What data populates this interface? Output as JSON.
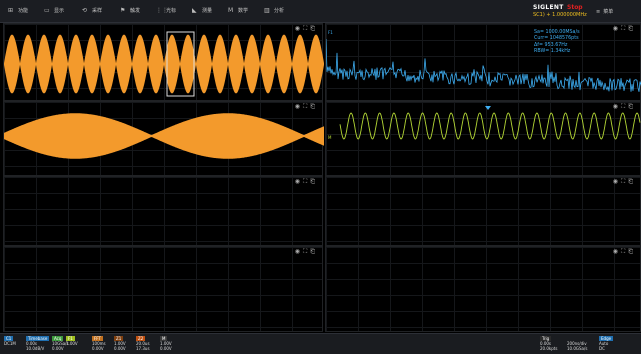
{
  "menu": {
    "items": [
      {
        "label": "功能",
        "icon": "grid-icon"
      },
      {
        "label": "显示",
        "icon": "display-icon"
      },
      {
        "label": "采样",
        "icon": "acquire-icon"
      },
      {
        "label": "触发",
        "icon": "flag-icon"
      },
      {
        "label": "光标",
        "icon": "cursor-icon"
      },
      {
        "label": "测量",
        "icon": "measure-icon"
      },
      {
        "label": "数学",
        "icon": "math-icon"
      },
      {
        "label": "分析",
        "icon": "analysis-icon"
      }
    ],
    "brand": "SIGLENT",
    "run_state": "Stop",
    "frequency": "SC1) + 1.000000MHz",
    "right_icon": "list-icon",
    "right_label": "菜单"
  },
  "fft_info": {
    "lines": [
      "Sa= 1000.00MSa/s",
      "Curr= 1048576pts",
      "Δf= 953.67Hz",
      "RBW= 1.34kHz"
    ]
  },
  "status": {
    "ch1": {
      "tag": "C1",
      "line1": "DC1M",
      "line2": "20.0dBV"
    },
    "timebase": {
      "tag": "Timebase",
      "line1": "0.00s",
      "line2": "10.0dB/V"
    },
    "acq": {
      "tag": "Acq",
      "line1": "10GSa/s",
      "line2": "0.00V"
    },
    "f1": {
      "tag": "F1",
      "line1": "1.00V",
      "line2": "0.00V"
    },
    "f2": {
      "tag": "FFT",
      "line1": "100ms",
      "line2": "0.00V"
    },
    "f3": {
      "tag": "Z1",
      "line1": "1.00V",
      "line2": "0.00V"
    },
    "f4": {
      "tag": "Z2",
      "line1": "20.0us",
      "line2": "17.3us"
    },
    "f5": {
      "tag": "M",
      "line1": "1.00V",
      "line2": "0.00V"
    },
    "trig": {
      "tag": "Trig",
      "line1": "0.00s",
      "line2": "20.0kpts"
    },
    "trig2": {
      "tag": "",
      "line1": "200ns/div",
      "line2": "10.0GSa/s"
    },
    "trig3": {
      "tag": "Edge",
      "line1": "Auto",
      "line2": "DC"
    }
  },
  "colors": {
    "ch1": "#f39a2c",
    "fft": "#3eaef2",
    "math": "#b5d936"
  }
}
